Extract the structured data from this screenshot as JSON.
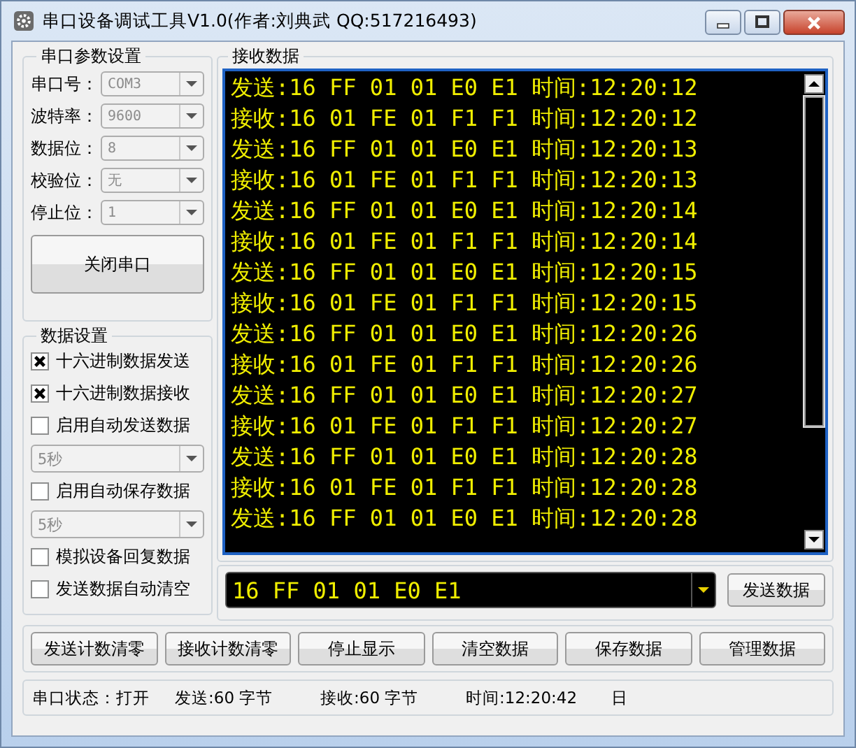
{
  "window": {
    "title": "串口设备调试工具V1.0(作者:刘典武   QQ:517216493)"
  },
  "serial_settings": {
    "title": "串口参数设置",
    "fields": [
      {
        "label": "串口号：",
        "value": "COM3",
        "disabled": true
      },
      {
        "label": "波特率：",
        "value": "9600",
        "disabled": true
      },
      {
        "label": "数据位：",
        "value": "8",
        "disabled": true
      },
      {
        "label": "校验位：",
        "value": "无",
        "disabled": true
      },
      {
        "label": "停止位：",
        "value": "1",
        "disabled": true
      }
    ],
    "button": "关闭串口"
  },
  "data_settings": {
    "title": "数据设置",
    "items": [
      {
        "kind": "checkbox",
        "label": "十六进制数据发送",
        "checked": true
      },
      {
        "kind": "checkbox",
        "label": "十六进制数据接收",
        "checked": true
      },
      {
        "kind": "checkbox",
        "label": "启用自动发送数据",
        "checked": false
      },
      {
        "kind": "select",
        "value": "5秒",
        "disabled": true
      },
      {
        "kind": "checkbox",
        "label": "启用自动保存数据",
        "checked": false
      },
      {
        "kind": "select",
        "value": "5秒",
        "disabled": true
      },
      {
        "kind": "checkbox",
        "label": "模拟设备回复数据",
        "checked": false
      },
      {
        "kind": "checkbox",
        "label": "发送数据自动清空",
        "checked": false
      }
    ]
  },
  "receive": {
    "title": "接收数据",
    "lines": [
      "发送:16 FF 01 01 E0 E1 时间:12:20:12",
      "接收:16 01 FE 01 F1 F1 时间:12:20:12",
      "发送:16 FF 01 01 E0 E1 时间:12:20:13",
      "接收:16 01 FE 01 F1 F1 时间:12:20:13",
      "发送:16 FF 01 01 E0 E1 时间:12:20:14",
      "接收:16 01 FE 01 F1 F1 时间:12:20:14",
      "发送:16 FF 01 01 E0 E1 时间:12:20:15",
      "接收:16 01 FE 01 F1 F1 时间:12:20:15",
      "发送:16 FF 01 01 E0 E1 时间:12:20:26",
      "接收:16 01 FE 01 F1 F1 时间:12:20:26",
      "发送:16 FF 01 01 E0 E1 时间:12:20:27",
      "接收:16 01 FE 01 F1 F1 时间:12:20:27",
      "发送:16 FF 01 01 E0 E1 时间:12:20:28",
      "接收:16 01 FE 01 F1 F1 时间:12:20:28",
      "发送:16 FF 01 01 E0 E1 时间:12:20:28"
    ]
  },
  "send": {
    "value": "16 FF 01 01 E0 E1",
    "button": "发送数据"
  },
  "buttons": [
    "发送计数清零",
    "接收计数清零",
    "停止显示",
    "清空数据",
    "保存数据",
    "管理数据"
  ],
  "status_bar": [
    "串口状态：打开",
    "发送:60 字节",
    "接收:60 字节",
    "时间:12:20:42",
    "日"
  ]
}
